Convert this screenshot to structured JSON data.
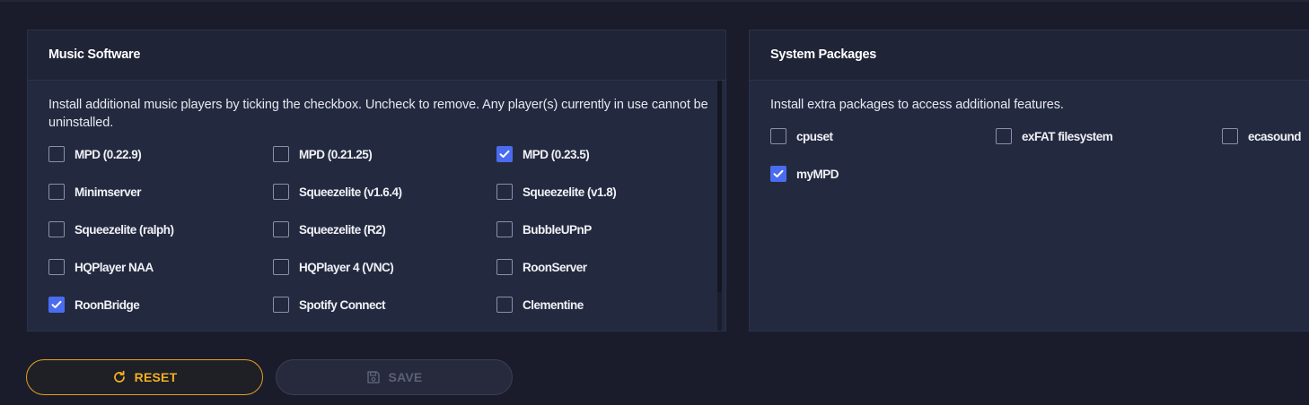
{
  "music_software": {
    "title": "Music Software",
    "description": "Install additional music players by ticking the checkbox. Uncheck to remove. Any player(s) currently in use cannot be uninstalled.",
    "options": [
      {
        "label": "MPD (0.22.9)",
        "checked": false
      },
      {
        "label": "MPD (0.21.25)",
        "checked": false
      },
      {
        "label": "MPD (0.23.5)",
        "checked": true
      },
      {
        "label": "Minimserver",
        "checked": false
      },
      {
        "label": "Squeezelite (v1.6.4)",
        "checked": false
      },
      {
        "label": "Squeezelite (v1.8)",
        "checked": false
      },
      {
        "label": "Squeezelite (ralph)",
        "checked": false
      },
      {
        "label": "Squeezelite (R2)",
        "checked": false
      },
      {
        "label": "BubbleUPnP",
        "checked": false
      },
      {
        "label": "HQPlayer NAA",
        "checked": false
      },
      {
        "label": "HQPlayer 4 (VNC)",
        "checked": false
      },
      {
        "label": "RoonServer",
        "checked": false
      },
      {
        "label": "RoonBridge",
        "checked": true
      },
      {
        "label": "Spotify Connect",
        "checked": false
      },
      {
        "label": "Clementine",
        "checked": false
      }
    ]
  },
  "system_packages": {
    "title": "System Packages",
    "description": "Install extra packages to access additional features.",
    "options": [
      {
        "label": "cpuset",
        "checked": false
      },
      {
        "label": "exFAT filesystem",
        "checked": false
      },
      {
        "label": "ecasound",
        "checked": false
      },
      {
        "label": "myMPD",
        "checked": true
      }
    ]
  },
  "actions": {
    "reset_label": "RESET",
    "save_label": "SAVE",
    "reset_icon": "refresh-icon",
    "save_icon": "floppy-disk-icon"
  },
  "colors": {
    "accent": "#4a6cf0",
    "reset": "#f2b021",
    "background": "#1a1c2b",
    "panel": "#232a40"
  }
}
